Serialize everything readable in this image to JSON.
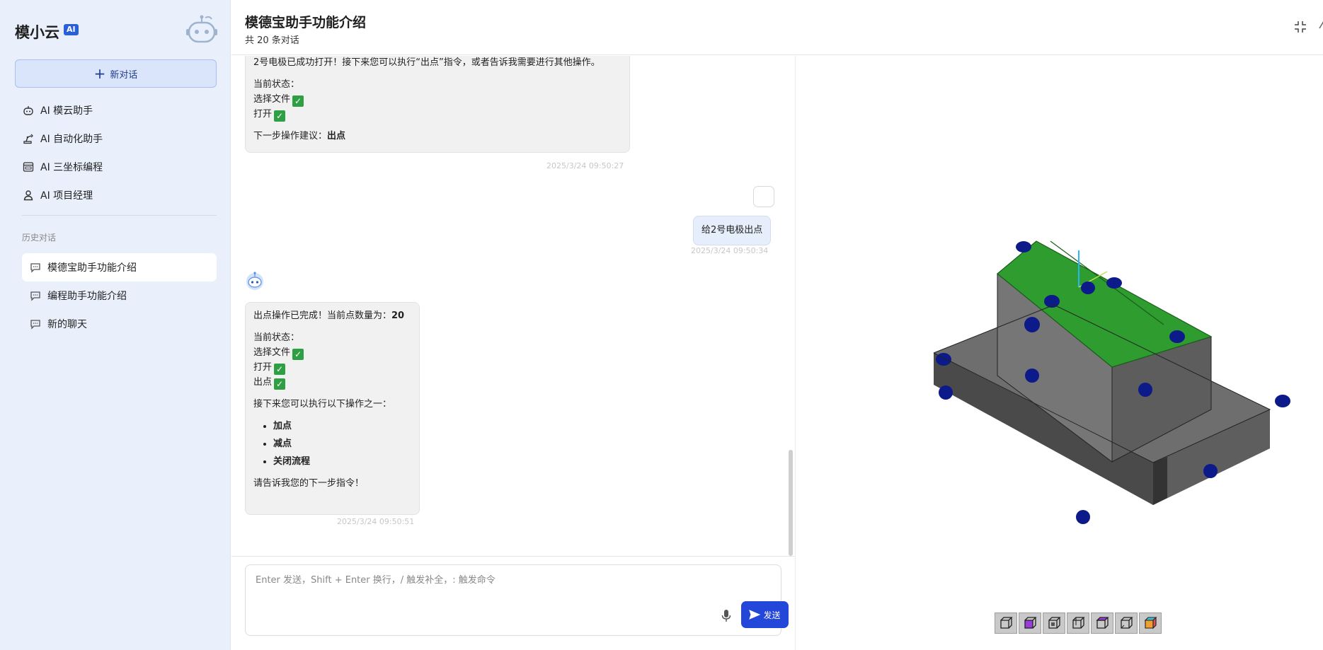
{
  "sidebar": {
    "brand": "模小云",
    "brand_badge": "AI",
    "new_chat_label": "新对话",
    "nav_items": [
      {
        "label": "AI 模云助手",
        "icon": "robot-icon"
      },
      {
        "label": "AI 自动化助手",
        "icon": "robotic-arm-icon"
      },
      {
        "label": "AI 三坐标编程",
        "icon": "cmm-icon"
      },
      {
        "label": "AI 项目经理",
        "icon": "user-icon"
      }
    ],
    "history_title": "历史对话",
    "history_items": [
      {
        "label": "模德宝助手功能介绍",
        "active": true
      },
      {
        "label": "编程助手功能介绍",
        "active": false
      },
      {
        "label": "新的聊天",
        "active": false
      }
    ]
  },
  "header": {
    "title": "模德宝助手功能介绍",
    "subtitle": "共 20 条对话"
  },
  "messages": {
    "bot1": {
      "line1": "2号电极已成功打开！接下来您可以执行“出点”指令，或者告诉我需要进行其他操作。",
      "status_title": "当前状态：",
      "status1": "选择文件",
      "status2": "打开",
      "next_prefix": "下一步操作建议：",
      "next_action": "出点",
      "timestamp": "2025/3/24 09:50:27"
    },
    "user1": {
      "text": "给2号电极出点",
      "timestamp": "2025/3/24 09:50:34"
    },
    "bot2": {
      "line1_prefix": "出点操作已完成！当前点数量为：",
      "point_count": "20",
      "status_title": "当前状态：",
      "status1": "选择文件",
      "status2": "打开",
      "status3": "出点",
      "options_title": "接下来您可以执行以下操作之一：",
      "options": [
        "加点",
        "减点",
        "关闭流程"
      ],
      "closing": "请告诉我您的下一步指令！",
      "timestamp": "2025/3/24 09:50:51"
    },
    "check_mark": "✓"
  },
  "input": {
    "placeholder": "Enter 发送，Shift + Enter 换行，/ 触发补全，: 触发命令",
    "value": "",
    "send_label": "发送"
  },
  "viewer": {
    "toolbar_buttons": [
      "view-front-icon",
      "view-top-icon",
      "view-right-icon",
      "view-back-icon",
      "view-bottom-icon",
      "view-left-icon",
      "view-iso-icon"
    ],
    "colors": {
      "base": "#6d6d6d",
      "top_face": "#2c9e2c",
      "points": "#0d1a8a"
    }
  },
  "colors": {
    "accent": "#2347d8",
    "sidebar_bg": "#e9f0fc",
    "check": "#2ea043"
  }
}
